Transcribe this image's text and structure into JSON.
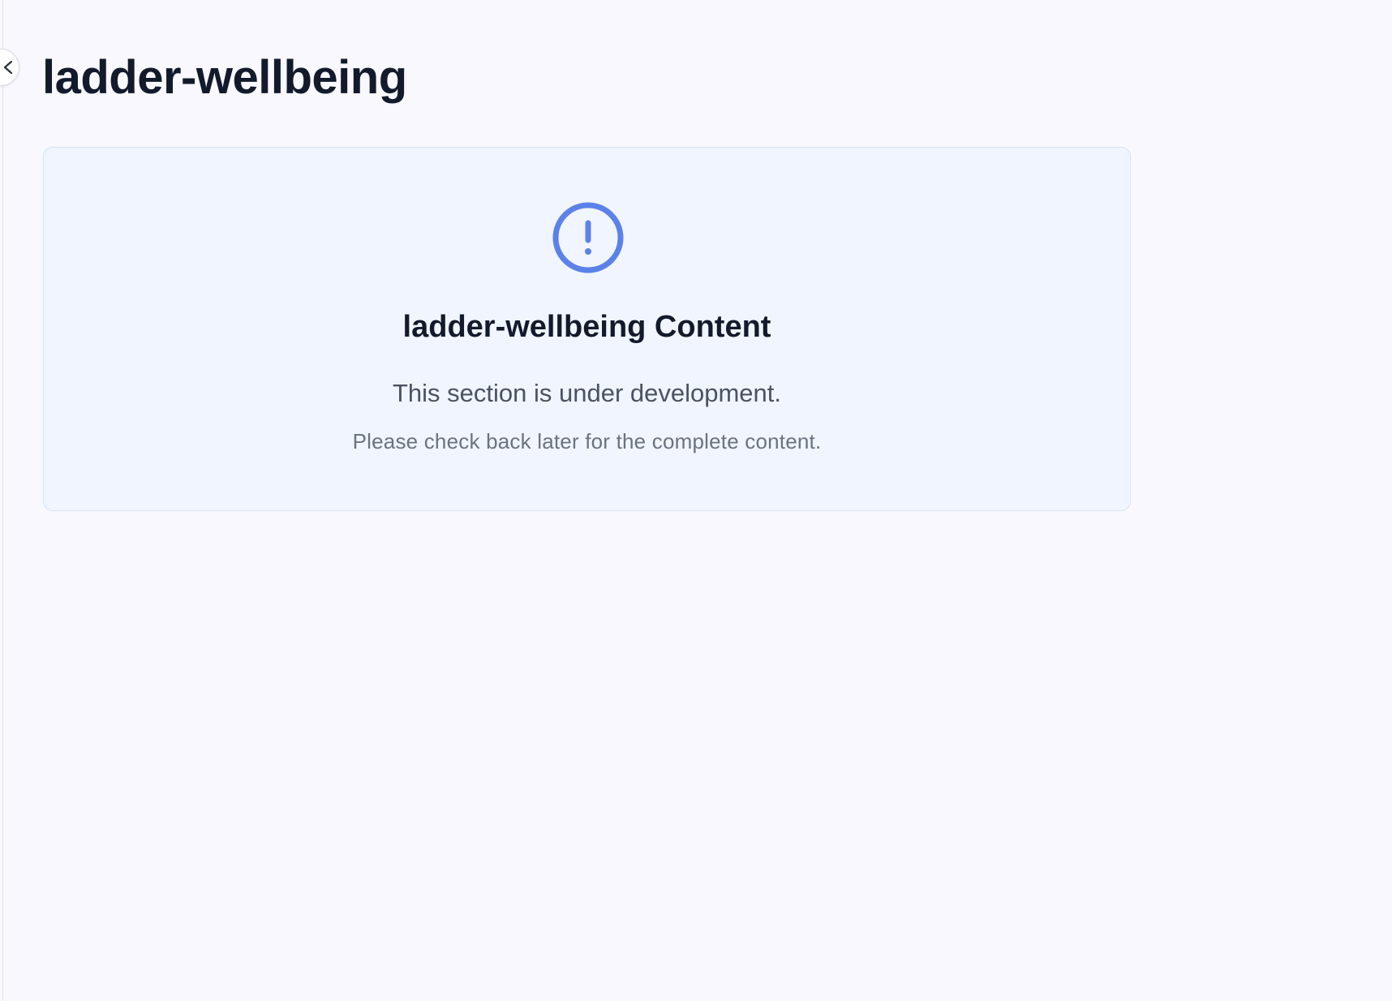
{
  "page": {
    "title": "ladder-wellbeing"
  },
  "sidebar_toggle": {
    "icon": "chevron-left-icon"
  },
  "notice": {
    "icon": "alert-circle-icon",
    "heading": "ladder-wellbeing Content",
    "message": "This section is under development.",
    "submessage": "Please check back later for the complete content."
  },
  "colors": {
    "background": "#f8f8fe",
    "card_background": "#f1f5ff",
    "card_border": "#d6e4f7",
    "accent": "#5b82e9",
    "title_text": "#121a2c"
  }
}
